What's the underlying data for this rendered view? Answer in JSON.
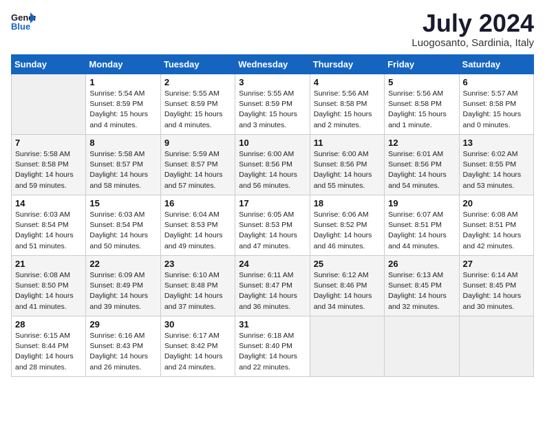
{
  "header": {
    "logo_line1": "General",
    "logo_line2": "Blue",
    "month": "July 2024",
    "location": "Luogosanto, Sardinia, Italy"
  },
  "days_of_week": [
    "Sunday",
    "Monday",
    "Tuesday",
    "Wednesday",
    "Thursday",
    "Friday",
    "Saturday"
  ],
  "weeks": [
    [
      {
        "day": "",
        "info": ""
      },
      {
        "day": "1",
        "info": "Sunrise: 5:54 AM\nSunset: 8:59 PM\nDaylight: 15 hours\nand 4 minutes."
      },
      {
        "day": "2",
        "info": "Sunrise: 5:55 AM\nSunset: 8:59 PM\nDaylight: 15 hours\nand 4 minutes."
      },
      {
        "day": "3",
        "info": "Sunrise: 5:55 AM\nSunset: 8:59 PM\nDaylight: 15 hours\nand 3 minutes."
      },
      {
        "day": "4",
        "info": "Sunrise: 5:56 AM\nSunset: 8:58 PM\nDaylight: 15 hours\nand 2 minutes."
      },
      {
        "day": "5",
        "info": "Sunrise: 5:56 AM\nSunset: 8:58 PM\nDaylight: 15 hours\nand 1 minute."
      },
      {
        "day": "6",
        "info": "Sunrise: 5:57 AM\nSunset: 8:58 PM\nDaylight: 15 hours\nand 0 minutes."
      }
    ],
    [
      {
        "day": "7",
        "info": "Sunrise: 5:58 AM\nSunset: 8:58 PM\nDaylight: 14 hours\nand 59 minutes."
      },
      {
        "day": "8",
        "info": "Sunrise: 5:58 AM\nSunset: 8:57 PM\nDaylight: 14 hours\nand 58 minutes."
      },
      {
        "day": "9",
        "info": "Sunrise: 5:59 AM\nSunset: 8:57 PM\nDaylight: 14 hours\nand 57 minutes."
      },
      {
        "day": "10",
        "info": "Sunrise: 6:00 AM\nSunset: 8:56 PM\nDaylight: 14 hours\nand 56 minutes."
      },
      {
        "day": "11",
        "info": "Sunrise: 6:00 AM\nSunset: 8:56 PM\nDaylight: 14 hours\nand 55 minutes."
      },
      {
        "day": "12",
        "info": "Sunrise: 6:01 AM\nSunset: 8:56 PM\nDaylight: 14 hours\nand 54 minutes."
      },
      {
        "day": "13",
        "info": "Sunrise: 6:02 AM\nSunset: 8:55 PM\nDaylight: 14 hours\nand 53 minutes."
      }
    ],
    [
      {
        "day": "14",
        "info": "Sunrise: 6:03 AM\nSunset: 8:54 PM\nDaylight: 14 hours\nand 51 minutes."
      },
      {
        "day": "15",
        "info": "Sunrise: 6:03 AM\nSunset: 8:54 PM\nDaylight: 14 hours\nand 50 minutes."
      },
      {
        "day": "16",
        "info": "Sunrise: 6:04 AM\nSunset: 8:53 PM\nDaylight: 14 hours\nand 49 minutes."
      },
      {
        "day": "17",
        "info": "Sunrise: 6:05 AM\nSunset: 8:53 PM\nDaylight: 14 hours\nand 47 minutes."
      },
      {
        "day": "18",
        "info": "Sunrise: 6:06 AM\nSunset: 8:52 PM\nDaylight: 14 hours\nand 46 minutes."
      },
      {
        "day": "19",
        "info": "Sunrise: 6:07 AM\nSunset: 8:51 PM\nDaylight: 14 hours\nand 44 minutes."
      },
      {
        "day": "20",
        "info": "Sunrise: 6:08 AM\nSunset: 8:51 PM\nDaylight: 14 hours\nand 42 minutes."
      }
    ],
    [
      {
        "day": "21",
        "info": "Sunrise: 6:08 AM\nSunset: 8:50 PM\nDaylight: 14 hours\nand 41 minutes."
      },
      {
        "day": "22",
        "info": "Sunrise: 6:09 AM\nSunset: 8:49 PM\nDaylight: 14 hours\nand 39 minutes."
      },
      {
        "day": "23",
        "info": "Sunrise: 6:10 AM\nSunset: 8:48 PM\nDaylight: 14 hours\nand 37 minutes."
      },
      {
        "day": "24",
        "info": "Sunrise: 6:11 AM\nSunset: 8:47 PM\nDaylight: 14 hours\nand 36 minutes."
      },
      {
        "day": "25",
        "info": "Sunrise: 6:12 AM\nSunset: 8:46 PM\nDaylight: 14 hours\nand 34 minutes."
      },
      {
        "day": "26",
        "info": "Sunrise: 6:13 AM\nSunset: 8:45 PM\nDaylight: 14 hours\nand 32 minutes."
      },
      {
        "day": "27",
        "info": "Sunrise: 6:14 AM\nSunset: 8:45 PM\nDaylight: 14 hours\nand 30 minutes."
      }
    ],
    [
      {
        "day": "28",
        "info": "Sunrise: 6:15 AM\nSunset: 8:44 PM\nDaylight: 14 hours\nand 28 minutes."
      },
      {
        "day": "29",
        "info": "Sunrise: 6:16 AM\nSunset: 8:43 PM\nDaylight: 14 hours\nand 26 minutes."
      },
      {
        "day": "30",
        "info": "Sunrise: 6:17 AM\nSunset: 8:42 PM\nDaylight: 14 hours\nand 24 minutes."
      },
      {
        "day": "31",
        "info": "Sunrise: 6:18 AM\nSunset: 8:40 PM\nDaylight: 14 hours\nand 22 minutes."
      },
      {
        "day": "",
        "info": ""
      },
      {
        "day": "",
        "info": ""
      },
      {
        "day": "",
        "info": ""
      }
    ]
  ]
}
